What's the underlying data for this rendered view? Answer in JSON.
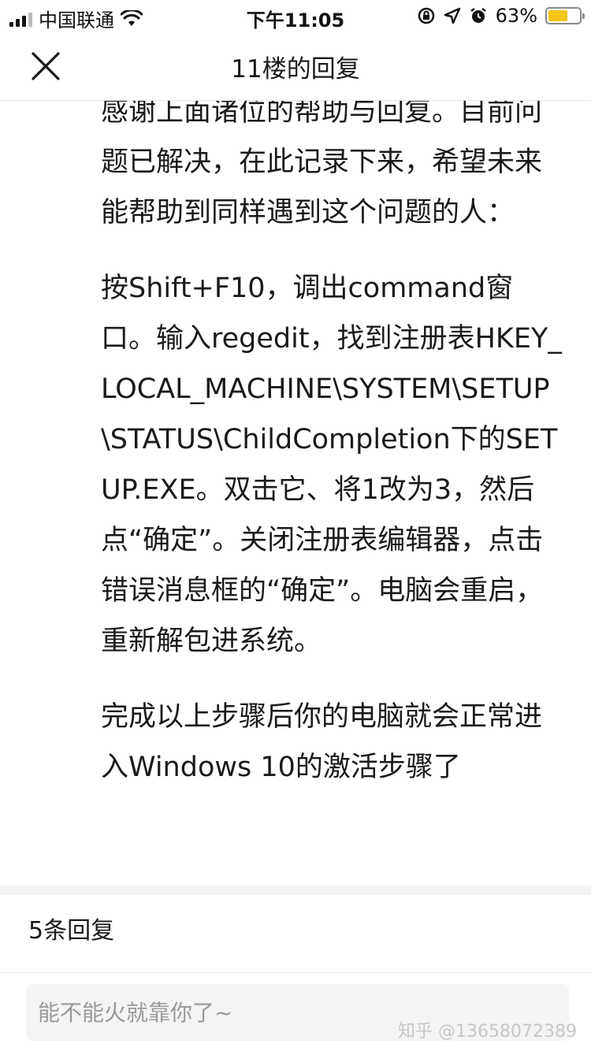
{
  "status_bar": {
    "carrier": "中国联通",
    "time": "下午11:05",
    "battery": "63%",
    "battery_level": 0.63
  },
  "header": {
    "title": "11楼的回复"
  },
  "content": {
    "paragraphs": [
      "感谢上面诸位的帮助与回复。目前问题已解决，在此记录下来，希望未来能帮助到同样遇到这个问题的人：",
      "按Shift+F10，调出command窗口。输入regedit，找到注册表HKEY_LOCAL_MACHINE\\SYSTEM\\SETUP\\STATUS\\ChildCompletion下的SETUP.EXE。双击它、将1改为3，然后点“确定”。关闭注册表编辑器，点击错误消息框的“确定”。电脑会重启，重新解包进系统。",
      "完成以上步骤后你的电脑就会正常进入Windows 10的激活步骤了"
    ]
  },
  "replies": {
    "count_label": "5条回复"
  },
  "comment": {
    "placeholder": "能不能火就靠你了~"
  },
  "watermark": "知乎 @13658072389",
  "colors": {
    "text": "#1a1a1a",
    "battery": "#f5c517",
    "band": "#f3f3f3"
  }
}
